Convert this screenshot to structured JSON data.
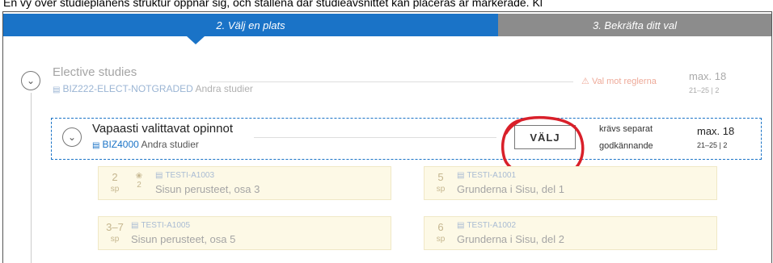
{
  "caption": "En vy över studieplanens struktur öppnar sig, och ställena där studieavsnittet kan placeras är markerade. Kl",
  "steps": {
    "active": "2. Välj en plats",
    "next": "3. Bekräfta ditt val"
  },
  "elective": {
    "title": "Elective studies",
    "code": "BIZ222-ELECT-NOTGRADED",
    "type": "Andra studier",
    "warning": "Val mot reglerna",
    "max": "max. 18",
    "range": "21–25",
    "range_extra": "2"
  },
  "selected": {
    "title": "Vapaasti valittavat opinnot",
    "code": "BIZ4000",
    "type": "Andra studier",
    "button": "VÄLJ",
    "note_line1": "krävs separat",
    "note_line2": "godkännande",
    "max": "max. 18",
    "range": "21–25",
    "range_extra": "2"
  },
  "courses": [
    {
      "sp": "2",
      "unit": "sp",
      "extra": "2",
      "code": "TESTI-A1003",
      "name": "Sisun perusteet, osa 3"
    },
    {
      "sp": "5",
      "unit": "sp",
      "code": "TESTI-A1001",
      "name": "Grunderna i Sisu, del 1"
    },
    {
      "sp": "3–7",
      "unit": "sp",
      "code": "TESTI-A1005",
      "name": "Sisun perusteet, osa 5"
    },
    {
      "sp": "6",
      "unit": "sp",
      "code": "TESTI-A1002",
      "name": "Grunderna i Sisu, del 2"
    }
  ],
  "colors": {
    "accent": "#1a73c7",
    "inactive_step": "#8c8c8c",
    "marker": "#d9202a",
    "card_bg": "#fdf9e6"
  }
}
